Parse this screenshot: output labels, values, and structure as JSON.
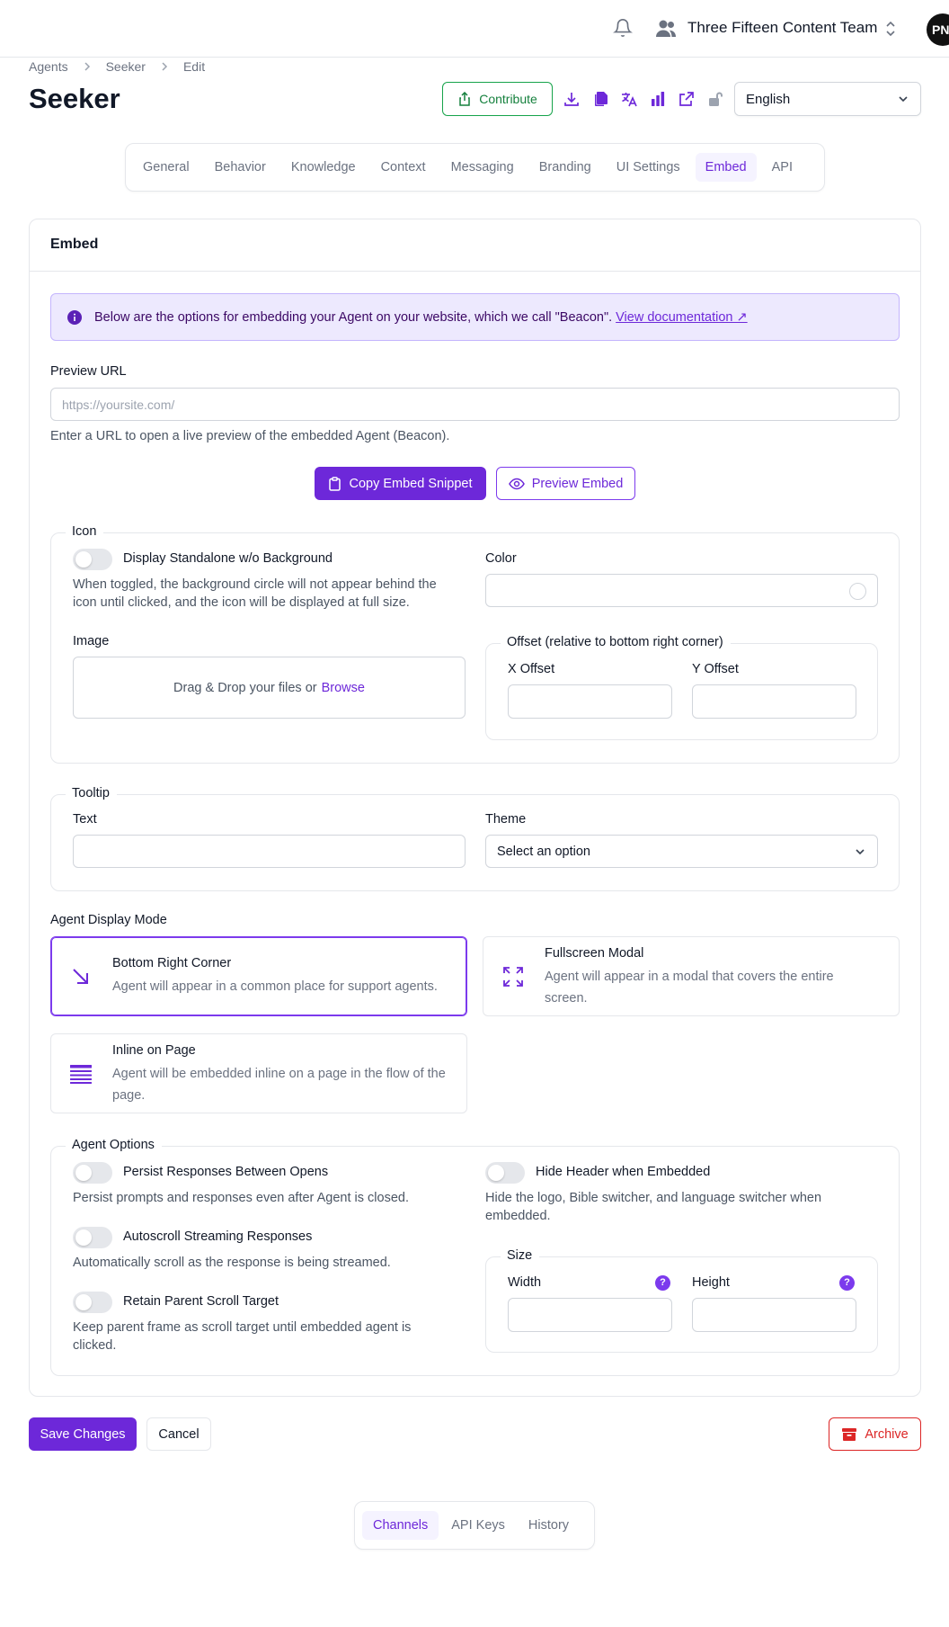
{
  "header": {
    "team_name": "Three Fifteen Content Team",
    "avatar_initials": "PN",
    "icons": [
      "bell-icon",
      "users-icon",
      "chevron-up-down-icon"
    ]
  },
  "breadcrumb": [
    "Agents",
    "Seeker",
    "Edit"
  ],
  "page_title": "Seeker",
  "toolbar": {
    "contribute_label": "Contribute",
    "icons": [
      "download-icon",
      "copy-icon",
      "translate-icon",
      "analytics-icon",
      "external-link-icon",
      "unlock-icon"
    ],
    "language_value": "English"
  },
  "tabs": [
    "General",
    "Behavior",
    "Knowledge",
    "Context",
    "Messaging",
    "Branding",
    "UI Settings",
    "Embed",
    "API"
  ],
  "active_tab": "Embed",
  "embed": {
    "card_title": "Embed",
    "info_text": "Below are the options for embedding your Agent on your website, which we call \"Beacon\".",
    "info_link": "View documentation ↗",
    "preview_url_label": "Preview URL",
    "preview_url_placeholder": "https://yoursite.com/",
    "preview_url_help": "Enter a URL to open a live preview of the embedded Agent (Beacon).",
    "copy_snippet_label": "Copy Embed Snippet",
    "preview_embed_label": "Preview Embed"
  },
  "icon_section": {
    "legend": "Icon",
    "standalone_label": "Display Standalone w/o Background",
    "standalone_help": "When toggled, the background circle will not appear behind the icon until clicked, and the icon will be displayed at full size.",
    "standalone_on": false,
    "color_label": "Color",
    "image_label": "Image",
    "dropzone_text": "Drag & Drop your files or",
    "dropzone_link": "Browse",
    "offset_legend": "Offset (relative to bottom right corner)",
    "x_offset_label": "X Offset",
    "y_offset_label": "Y Offset"
  },
  "tooltip_section": {
    "legend": "Tooltip",
    "text_label": "Text",
    "theme_label": "Theme",
    "theme_placeholder": "Select an option"
  },
  "display_mode": {
    "label": "Agent Display Mode",
    "options": [
      {
        "title": "Bottom Right Corner",
        "desc": "Agent will appear in a common place for support agents.",
        "icon": "arrow-down-right-icon",
        "selected": true
      },
      {
        "title": "Fullscreen Modal",
        "desc": "Agent will appear in a modal that covers the entire screen.",
        "icon": "expand-icon",
        "selected": false
      },
      {
        "title": "Inline on Page",
        "desc": "Agent will be embedded inline on a page in the flow of the page.",
        "icon": "inline-lines-icon",
        "selected": false
      }
    ]
  },
  "agent_options": {
    "legend": "Agent Options",
    "persist_label": "Persist Responses Between Opens",
    "persist_help": "Persist prompts and responses even after Agent is closed.",
    "autoscroll_label": "Autoscroll Streaming Responses",
    "autoscroll_help": "Automatically scroll as the response is being streamed.",
    "retain_label": "Retain Parent Scroll Target",
    "retain_help": "Keep parent frame as scroll target until embedded agent is clicked.",
    "hide_header_label": "Hide Header when Embedded",
    "hide_header_help": "Hide the logo, Bible switcher, and language switcher when embedded.",
    "size_legend": "Size",
    "width_label": "Width",
    "height_label": "Height",
    "help_glyph": "?"
  },
  "actions": {
    "save_label": "Save Changes",
    "cancel_label": "Cancel",
    "archive_label": "Archive"
  },
  "bottom_tabs": [
    "Channels",
    "API Keys",
    "History"
  ],
  "bottom_active": "Channels",
  "colors": {
    "accent": "#6d28d9",
    "danger": "#dc2626",
    "success": "#16a34a",
    "info_bg": "#ede9fe"
  }
}
